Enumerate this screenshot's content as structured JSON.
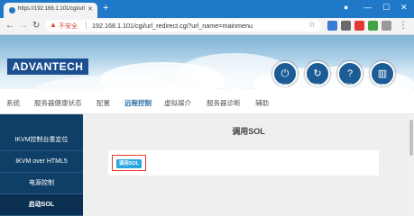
{
  "browser": {
    "tab_title": "https://192.168.1.101/cgi/url",
    "address_warning": "不安全",
    "address_url": "192.168.1.101/cgi/url_redirect.cgi?url_name=mainmenu"
  },
  "header": {
    "logo_text": "ADVANTECH",
    "buttons": [
      {
        "label": "登出",
        "icon": "logout-icon"
      },
      {
        "label": "刷新",
        "icon": "refresh-icon"
      },
      {
        "label": "帮助",
        "icon": "help-icon"
      },
      {
        "label": "关于",
        "icon": "book-icon"
      }
    ]
  },
  "nav": {
    "items": [
      "系统",
      "服务器健康状态",
      "配置",
      "远程控制",
      "虚拟媒介",
      "服务器诊断",
      "辅助"
    ],
    "active": "远程控制"
  },
  "sidebar": {
    "items": [
      "IKVM控制台重定位",
      "IKVM over HTML5",
      "电源控制",
      "启动SOL"
    ],
    "selected": "启动SOL"
  },
  "main": {
    "title": "调用SOL",
    "button_label": "调用SOL"
  },
  "colors": {
    "titlebar": "#1f78c8",
    "sidebar": "#0f3e66",
    "accent_button": "#2aa7e0",
    "highlight": "#e53a2e"
  }
}
